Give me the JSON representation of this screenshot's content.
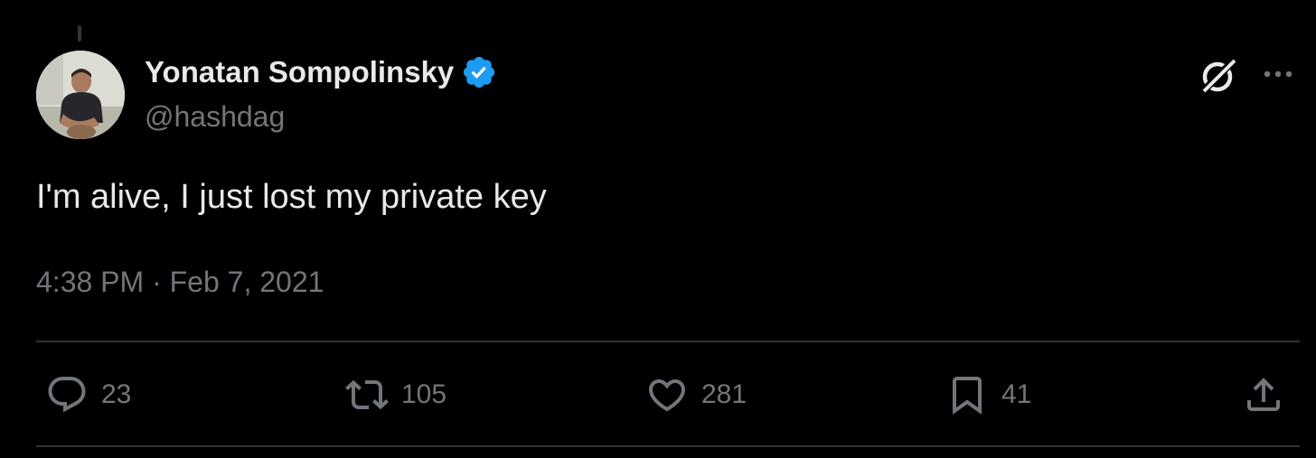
{
  "author": {
    "name": "Yonatan Sompolinsky",
    "handle": "@hashdag",
    "verified": true
  },
  "tweet": {
    "text": "I'm alive, I just lost my private key",
    "timestamp": "4:38 PM · Feb 7, 2021"
  },
  "actions": {
    "replies": "23",
    "retweets": "105",
    "likes": "281",
    "bookmarks": "41"
  },
  "icons": {
    "grok": "grok-icon",
    "more": "more-icon",
    "reply": "reply-icon",
    "retweet": "retweet-icon",
    "like": "heart-icon",
    "bookmark": "bookmark-icon",
    "share": "share-icon",
    "verified": "verified-badge-icon"
  },
  "colors": {
    "background": "#000000",
    "primary_text": "#e7e9ea",
    "secondary_text": "#71767b",
    "verified_blue": "#1d9bf0",
    "divider": "#2f3336"
  }
}
